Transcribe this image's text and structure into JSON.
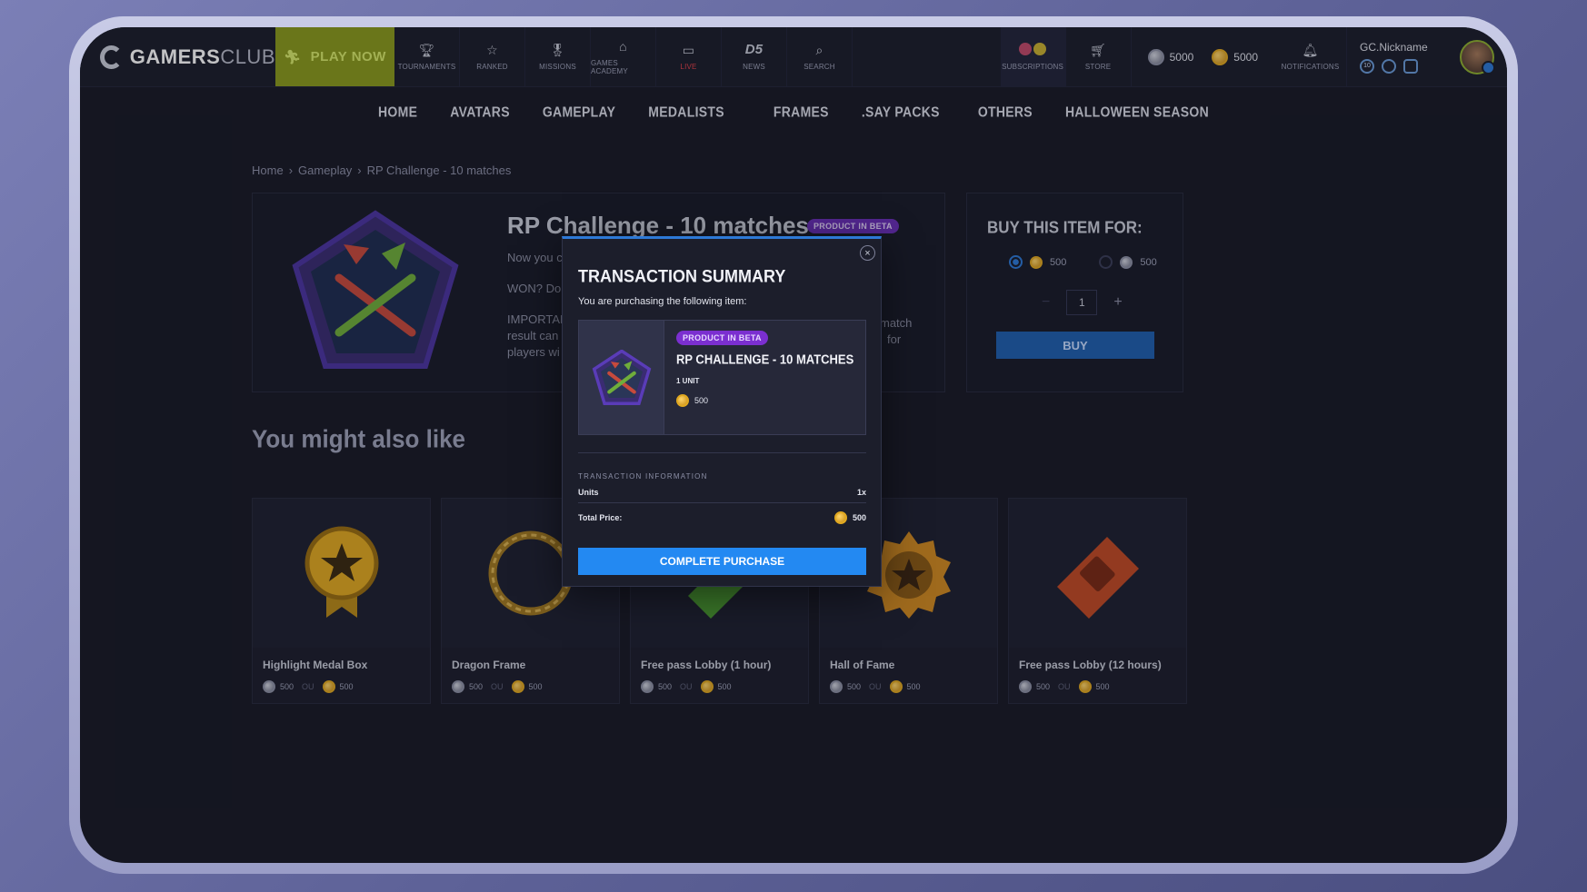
{
  "header": {
    "logo_bold": "GAMERS",
    "logo_light": "CLUB",
    "play_label": "PLAY NOW",
    "nav": [
      {
        "label": "TOURNAMENTS",
        "icon": "trophy-icon"
      },
      {
        "label": "RANKED",
        "icon": "star-icon"
      },
      {
        "label": "MISSIONS",
        "icon": "medal-icon"
      },
      {
        "label": "GAMES ACADEMY",
        "icon": "graduation-cap-icon"
      },
      {
        "label": "LIVE",
        "icon": "monitor-icon"
      },
      {
        "label": "NEWS",
        "icon": "news-icon",
        "glyph": "D5"
      },
      {
        "label": "SEARCH",
        "icon": "search-icon"
      }
    ],
    "subscriptions_label": "SUBSCRIPTIONS",
    "store_label": "STORE",
    "silver_balance": "5000",
    "gold_balance": "5000",
    "notifications_label": "NOTIFICATIONS",
    "nickname": "GC.Nickname",
    "level_badge": "10"
  },
  "categories": [
    "HOME",
    "AVATARS",
    "GAMEPLAY",
    "MEDALISTS",
    "FRAMES",
    ".SAY PACKS",
    "OTHERS",
    "HALLOWEEN SEASON"
  ],
  "breadcrumb": [
    "Home",
    "Gameplay",
    "RP Challenge - 10 matches"
  ],
  "product": {
    "title": "RP Challenge - 10 matches",
    "badge": "PRODUCT IN BETA",
    "desc_line1": "Now you c",
    "desc_line2": "WON? Dou",
    "desc_line3a": "IMPORTAN",
    "desc_line3b": "result can",
    "desc_line3c": "players wi",
    "desc_right1": "match",
    "desc_right2": "for"
  },
  "buy": {
    "heading": "BUY THIS ITEM FOR:",
    "gold_price": "500",
    "silver_price": "500",
    "quantity": "1",
    "minus": "−",
    "plus": "+",
    "button": "BUY"
  },
  "also_like": {
    "heading": "You might also like",
    "or_label": "OU",
    "cards": [
      {
        "name": "Highlight Medal Box",
        "silver": "500",
        "gold": "500"
      },
      {
        "name": "Dragon Frame",
        "silver": "500",
        "gold": "500"
      },
      {
        "name": "Free pass Lobby (1 hour)",
        "silver": "500",
        "gold": "500"
      },
      {
        "name": "Hall of Fame",
        "silver": "500",
        "gold": "500"
      },
      {
        "name": "Free pass Lobby (12 hours)",
        "silver": "500",
        "gold": "500"
      }
    ]
  },
  "modal": {
    "close_glyph": "×",
    "title": "TRANSACTION SUMMARY",
    "subtitle": "You are purchasing the following item:",
    "item_badge": "PRODUCT IN BETA",
    "item_name": "RP CHALLENGE - 10 MATCHES",
    "item_unit": "1 UNIT",
    "item_price": "500",
    "info_heading": "TRANSACTION INFORMATION",
    "units_label": "Units",
    "units_value": "1x",
    "total_label": "Total Price:",
    "total_value": "500",
    "cta": "COMPLETE PURCHASE"
  },
  "colors": {
    "accent_blue": "#2389f2",
    "beta_purple": "#7b2fd0",
    "play_green": "#8a9a1c",
    "gold": "#e0a820"
  }
}
